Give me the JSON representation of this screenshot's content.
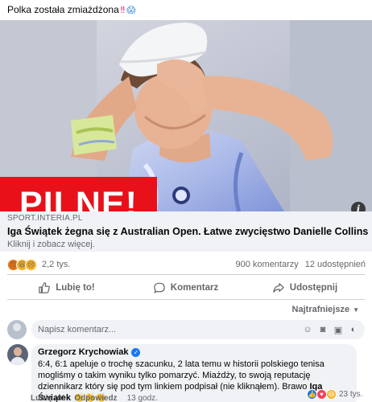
{
  "post": {
    "caption": "Polka została zmiażdżona",
    "caption_emoji_1": "‼",
    "caption_emoji_2": "😱"
  },
  "media": {
    "badge": "PILNE!",
    "info_icon": "info-icon",
    "scene": "tennis player with white visor covering face"
  },
  "link": {
    "domain": "SPORT.INTERIA.PL",
    "title": "Iga Świątek żegna się z Australian Open. Łatwe zwycięstwo Danielle Collins",
    "subtitle": "Kliknij i zobacz więcej."
  },
  "stats": {
    "reactions_count": "2,2 tys.",
    "comments": "900 komentarzy",
    "shares": "12 udostępnień",
    "reaction_icons": [
      "angry-reaction-icon",
      "haha-reaction-icon",
      "sad-reaction-icon"
    ]
  },
  "actions": {
    "like": "Lubię to!",
    "comment": "Komentarz",
    "share": "Udostępnij"
  },
  "sort": {
    "label": "Najtrafniejsze"
  },
  "comment_input": {
    "placeholder": "Napisz komentarz..."
  },
  "comment": {
    "author": "Grzegorz Krychowiak",
    "text": "6:4, 6:1 apeluje o trochę szacunku, 2 lata temu w historii polskiego tenisa mogliśmy o takim wyniku tylko pomarzyć. Miażdży, to swoją reputację dziennikarz który się pod tym linkiem podpisał (nie kliknąłem). Brawo",
    "tag": "Iga Świątek",
    "claps": "👏👏👏",
    "like_label": "Lubię to!",
    "reply_label": "Odpowiedz",
    "time": "13 godz.",
    "reactions_count": "23 tys."
  },
  "colors": {
    "badge_red": "#e8111a",
    "fb_gray": "#65676b",
    "fb_blue": "#1877f2",
    "panel_bg": "#f0f2f5"
  }
}
